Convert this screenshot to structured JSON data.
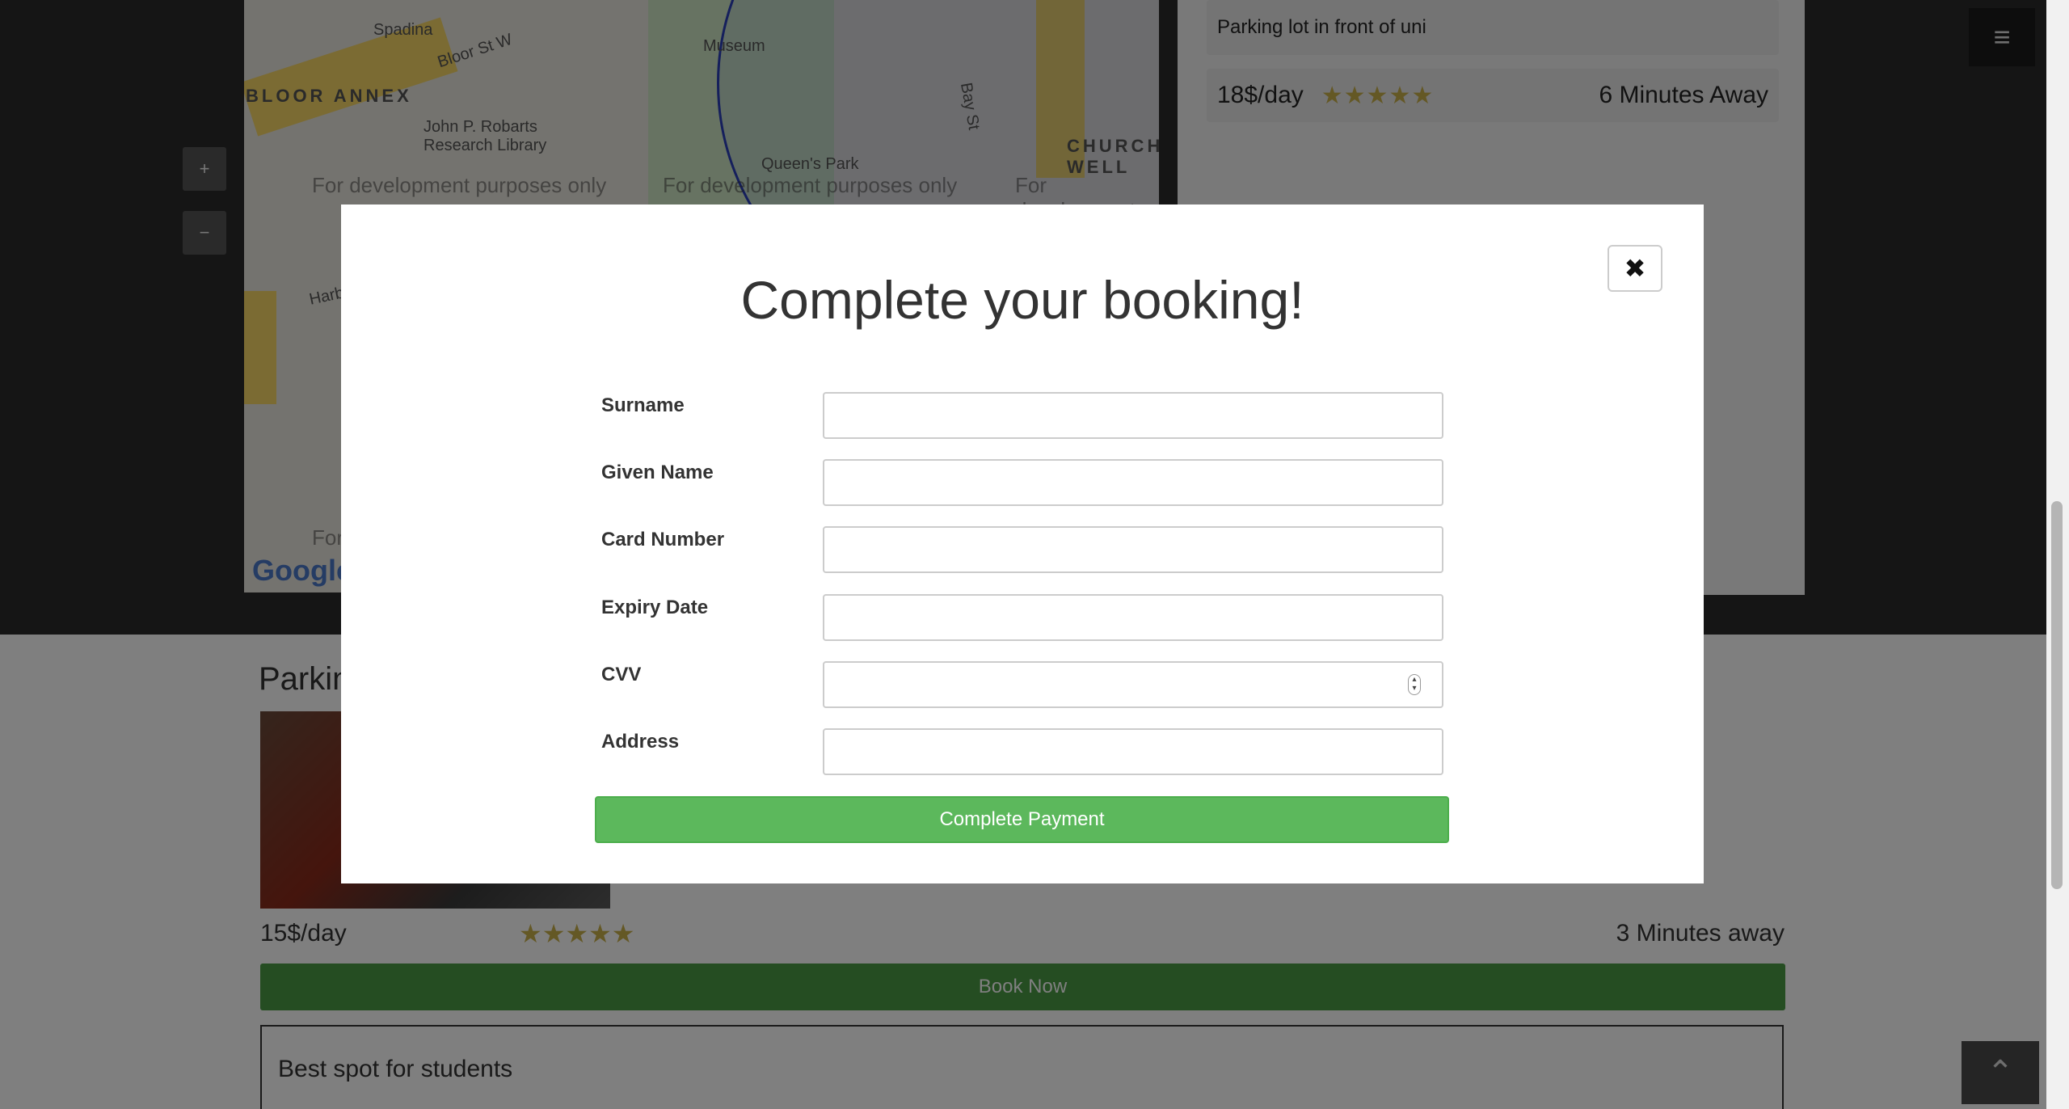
{
  "map": {
    "dev_watermark": "For development purposes only",
    "labels": {
      "spadina": "Spadina",
      "bloor_annex": "BLOOR ANNEX",
      "bloor_st": "Bloor St W",
      "museum": "Museum",
      "robarts": "John P. Robarts Research Library",
      "queens_park": "Queen's Park",
      "church": "CHURCH WELL",
      "harbord": "Harbord St",
      "bay_st": "Bay St",
      "google": "Google"
    },
    "zoom_in": "+",
    "zoom_out": "−"
  },
  "top_listing": {
    "description": "Parking lot in front of uni",
    "price": "18$/day",
    "stars": "★★★★★",
    "distance": "6 Minutes Away"
  },
  "nav": {
    "menu_icon": "≡"
  },
  "lower_listing": {
    "title": "Parkin",
    "price": "15$/day",
    "stars": "★★★★★",
    "distance": "3 Minutes away",
    "book_label": "Book Now",
    "review_title": "Best spot for students"
  },
  "scroll_top_icon": "⌃",
  "modal": {
    "title": "Complete your booking!",
    "close_icon": "✖",
    "fields": [
      {
        "label": "Surname",
        "value": ""
      },
      {
        "label": "Given Name",
        "value": ""
      },
      {
        "label": "Card Number",
        "value": ""
      },
      {
        "label": "Expiry Date",
        "value": ""
      },
      {
        "label": "CVV",
        "value": ""
      },
      {
        "label": "Address",
        "value": ""
      }
    ],
    "submit_label": "Complete Payment"
  },
  "colors": {
    "primary_green": "#5cb85c",
    "book_green": "#4a9a44",
    "star_gold": "#c9b04a"
  }
}
